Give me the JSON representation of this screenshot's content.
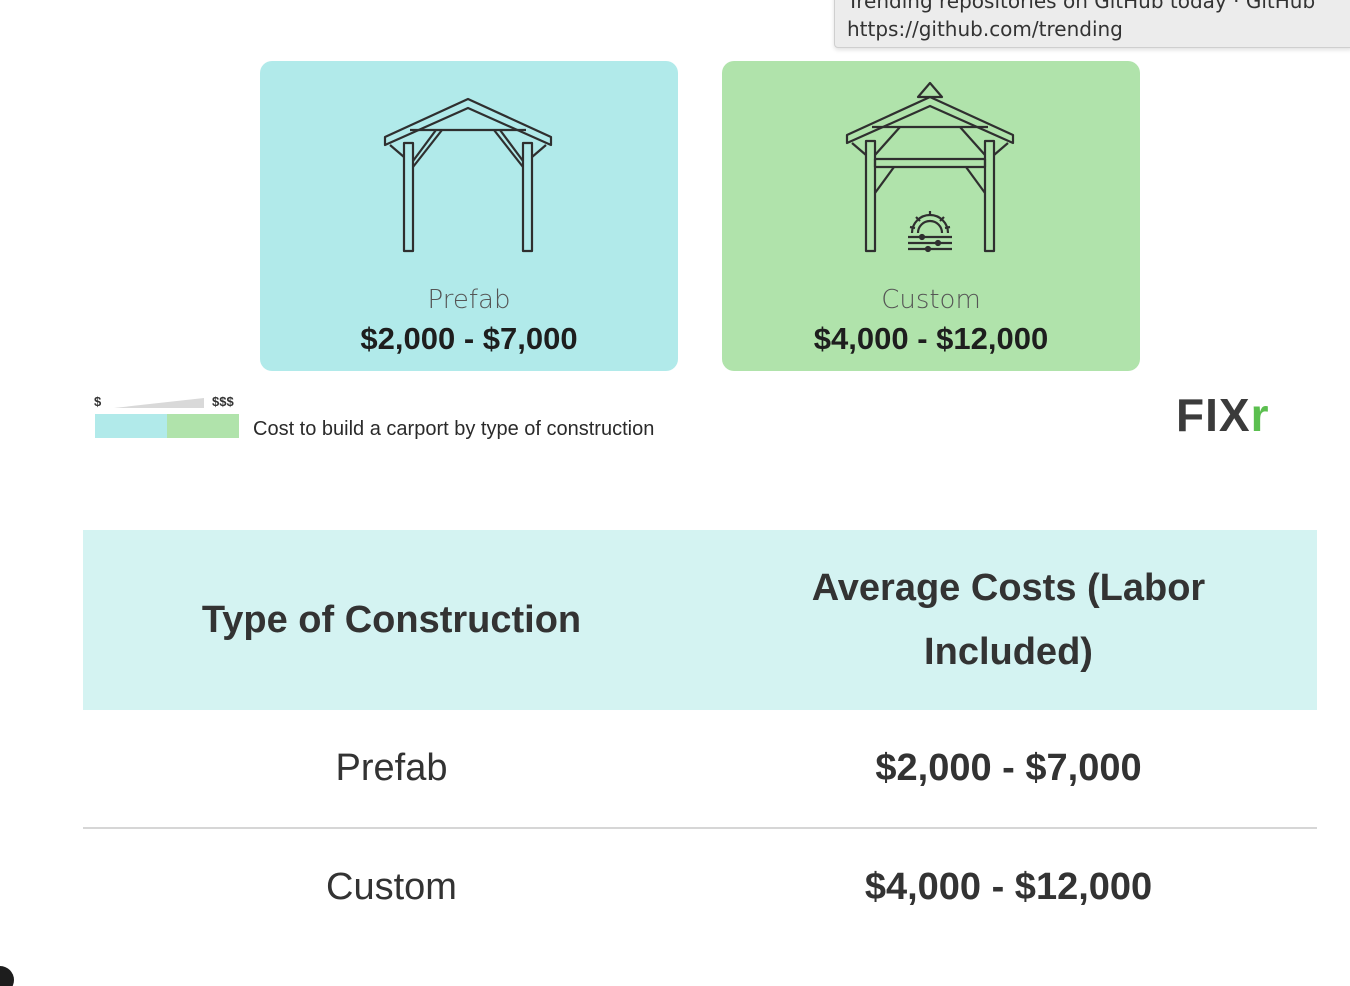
{
  "tooltip": {
    "title": "Trending repositories on GitHub today · GitHub",
    "url": "https://github.com/trending"
  },
  "cards": [
    {
      "label": "Prefab",
      "price": "$2,000 - $7,000",
      "color": "#b1eaea",
      "icon": "prefab-carport-icon"
    },
    {
      "label": "Custom",
      "price": "$4,000 - $12,000",
      "color": "#b0e3ab",
      "icon": "custom-carport-icon"
    }
  ],
  "legend": {
    "min_label": "$",
    "max_label": "$$$"
  },
  "caption": "Cost to build a carport by type of construction",
  "logo": {
    "main": "FIX",
    "accent": "r"
  },
  "table": {
    "headers": [
      "Type of Construction",
      "Average Costs (Labor Included)"
    ],
    "rows": [
      [
        "Prefab",
        "$2,000 - $7,000"
      ],
      [
        "Custom",
        "$4,000 - $12,000"
      ]
    ]
  },
  "colors": {
    "prefab": "#b1eaea",
    "custom": "#b0e3ab",
    "table_header": "#d4f3f2"
  }
}
